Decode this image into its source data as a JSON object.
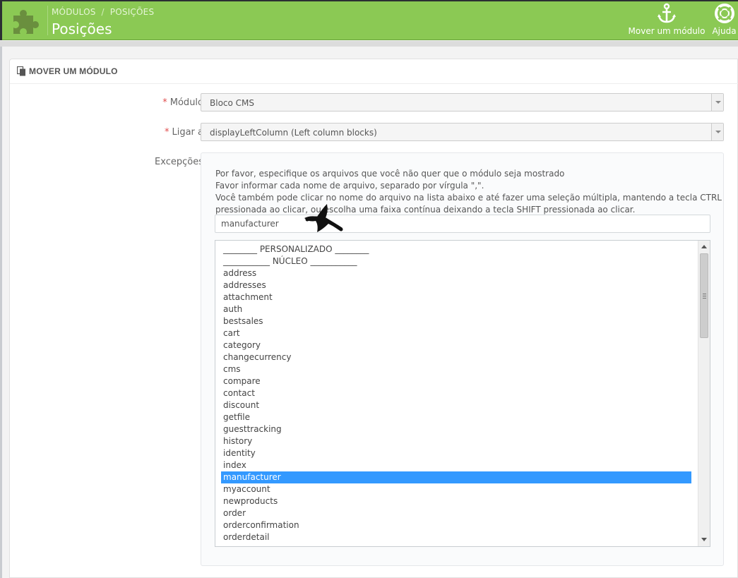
{
  "header": {
    "breadcrumb": [
      "MÓDULOS",
      "POSIÇÕES"
    ],
    "breadcrumb_separator": "/",
    "title": "Posições",
    "logo_icon": "puzzle-icon",
    "accent_color": "#8bc954",
    "toolbar": {
      "move_module": {
        "label": "Mover um módulo",
        "icon": "anchor-icon"
      },
      "help": {
        "label": "Ajuda",
        "icon": "lifebuoy-icon"
      }
    }
  },
  "panel": {
    "heading": "MOVER UM MÓDULO",
    "heading_icon": "copy-icon",
    "fields": {
      "module": {
        "required_mark": "*",
        "label": "Módulo",
        "value": "Bloco CMS"
      },
      "hook": {
        "required_mark": "*",
        "label": "Ligar a",
        "value": "displayLeftColumn (Left column blocks)"
      },
      "exceptions": {
        "label": "Excepções",
        "help_lines": [
          "Por favor, especifique os arquivos que você não quer que o módulo seja mostrado",
          "Favor informar cada nome de arquivo, separado por vírgula \",\".",
          "Você também pode clicar no nome do arquivo na lista abaixo e até fazer uma seleção múltipla, mantendo a tecla CTRL",
          "pressionada ao clicar, ou escolha uma faixa contínua deixando a tecla SHIFT pressionada ao clicar."
        ],
        "input_value": "manufacturer",
        "files": [
          "________ PERSONALIZADO ________",
          "___________ NÚCLEO ___________",
          "address",
          "addresses",
          "attachment",
          "auth",
          "bestsales",
          "cart",
          "category",
          "changecurrency",
          "cms",
          "compare",
          "contact",
          "discount",
          "getfile",
          "guesttracking",
          "history",
          "identity",
          "index",
          "manufacturer",
          "myaccount",
          "newproducts",
          "order",
          "orderconfirmation",
          "orderdetail"
        ],
        "selected_file": "manufacturer",
        "selected_color": "#3399ff"
      }
    }
  }
}
